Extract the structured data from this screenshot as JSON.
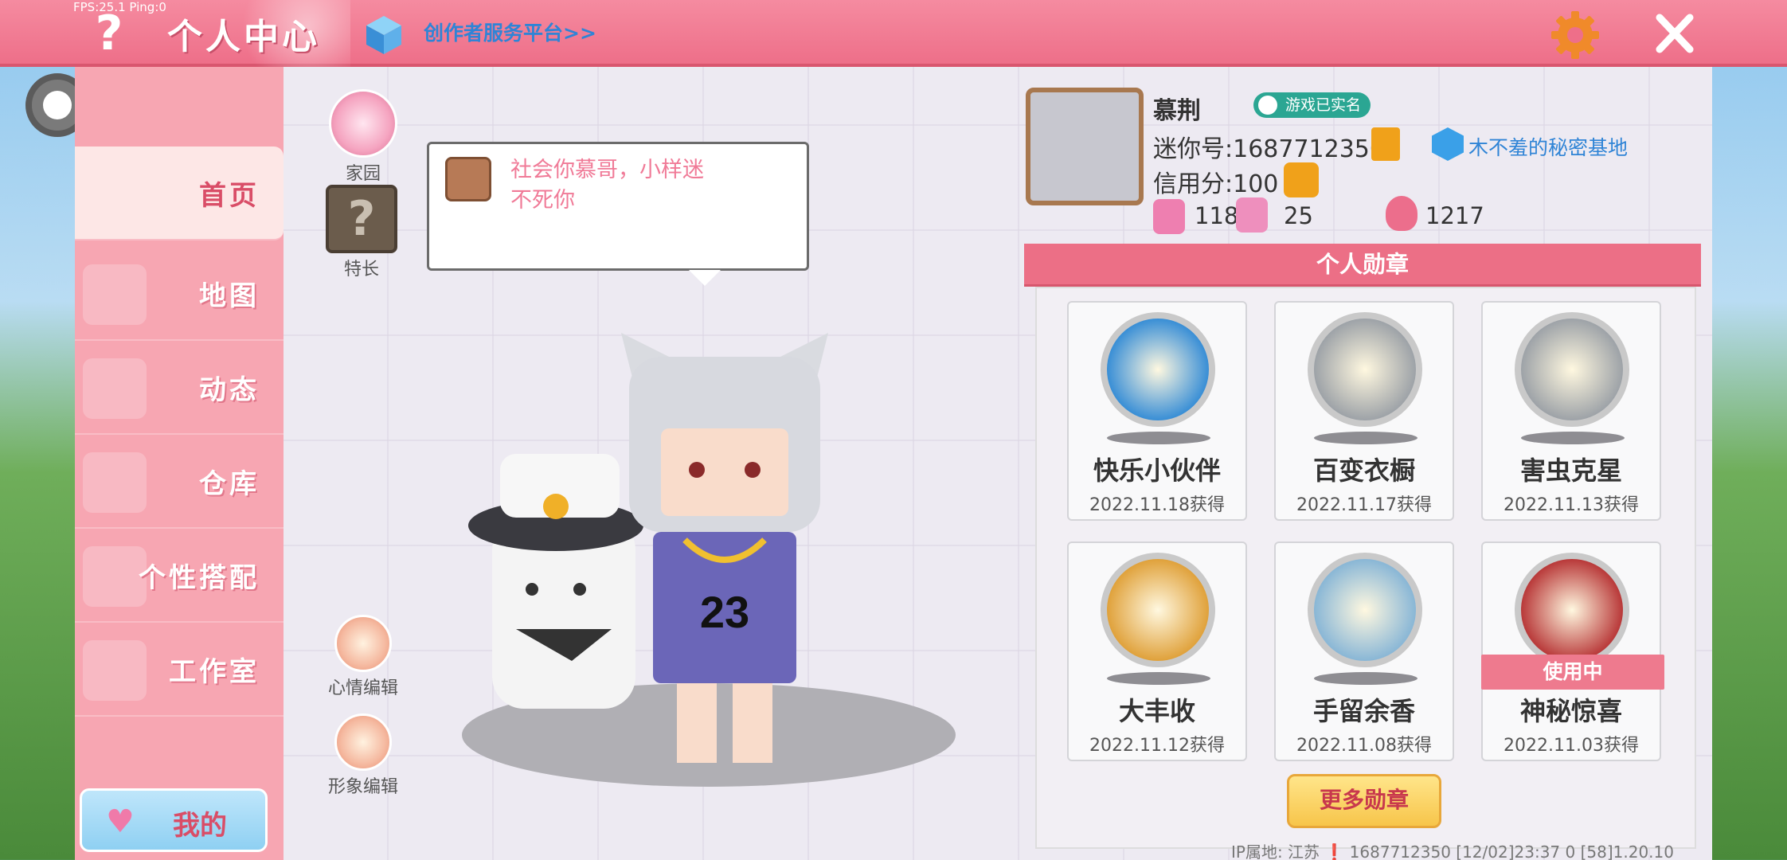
{
  "top_bar": {
    "fps": "FPS:25.1  Ping:0",
    "title": "个人中心",
    "creator_link": "创作者服务平台>>"
  },
  "sidebar": {
    "items": [
      {
        "label": "首页",
        "active": true
      },
      {
        "label": "地图"
      },
      {
        "label": "动态"
      },
      {
        "label": "仓库"
      },
      {
        "label": "个性搭配"
      },
      {
        "label": "工作室"
      }
    ],
    "me_label": "我的"
  },
  "side_buttons": {
    "home": "家园",
    "skill": "特长",
    "mood_edit": "心情编辑",
    "avatar_edit": "形象编辑"
  },
  "bubble_text": "社会你慕哥，小样迷不死你",
  "profile": {
    "nickname": "慕荆",
    "realname_badge": "游戏已实名",
    "uid": "迷你号:1687712350",
    "base_link": "木不羞的秘密基地",
    "credit": "信用分:100",
    "likes": "118",
    "fans": "25",
    "heat": "1217"
  },
  "medals": {
    "header": "个人勋章",
    "items": [
      {
        "name": "快乐小伙伴",
        "date": "2022.11.18获得",
        "color": "#3a8fd6"
      },
      {
        "name": "百变衣橱",
        "date": "2022.11.17获得",
        "color": "#9ea3a8"
      },
      {
        "name": "害虫克星",
        "date": "2022.11.13获得",
        "color": "#9ea3a8"
      },
      {
        "name": "大丰收",
        "date": "2022.11.12获得",
        "color": "#e0a23c"
      },
      {
        "name": "手留余香",
        "date": "2022.11.08获得",
        "color": "#8ab7d6"
      },
      {
        "name": "神秘惊喜",
        "date": "2022.11.03获得",
        "color": "#b93a3a",
        "in_use": "使用中"
      }
    ],
    "more_button": "更多勋章"
  },
  "footer": "IP属地: 江苏 ❗   1687712350   [12/02]23:37 0   [58]1.20.10"
}
